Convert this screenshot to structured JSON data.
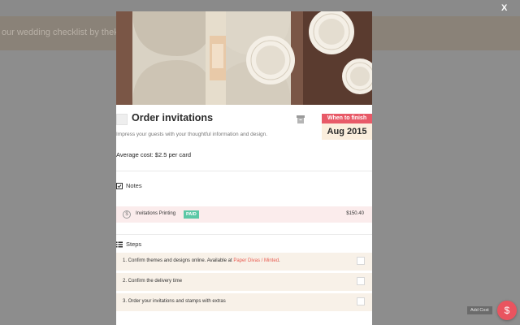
{
  "background": {
    "banner_text": "our wedding checklist by theknot…"
  },
  "modal": {
    "title": "Order invitations",
    "description": "Impress your guests with your thoughtful information and design.",
    "average_cost": "Average cost: $2.5 per card",
    "when_label": "When to finish",
    "when_date": "Aug 2015",
    "notes": {
      "heading": "Notes",
      "items": [
        {
          "label": "Invitations Printing",
          "badge": "PAID",
          "amount": "$150.40"
        }
      ]
    },
    "steps": {
      "heading": "Steps",
      "items": [
        {
          "text_before": "1. Confirm themes and designs online. Available at ",
          "link1": "Paper Divas",
          "separator": " / ",
          "link2": "Minted",
          "text_after": "."
        },
        {
          "text": "2. Confirm the delivery time"
        },
        {
          "text": "3. Order your invitations and stamps with extras"
        }
      ]
    }
  },
  "close_label": "X",
  "add_cost_label": "Add Cost",
  "fab_symbol": "$",
  "colors": {
    "accent": "#e85a68",
    "paid": "#5cc8a6",
    "note_bg": "#fbecec",
    "step_bg": "#f8f1e8",
    "date_bg": "#fbeedd"
  }
}
